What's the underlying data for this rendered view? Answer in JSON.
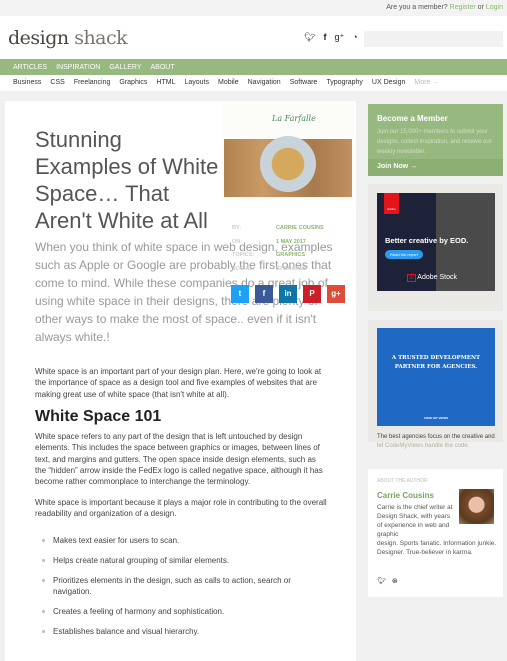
{
  "topbar": {
    "question": "Are you a member?",
    "register": "Register",
    "or": "or",
    "login": "Login"
  },
  "logo": {
    "word1": "design",
    "word2": "shack"
  },
  "social_icons": [
    "twitter-icon",
    "facebook-icon",
    "google-plus-icon",
    "rss-icon"
  ],
  "nav": [
    "ARTICLES",
    "INSPIRATION",
    "GALLERY",
    "ABOUT"
  ],
  "subnav": [
    "Business",
    "CSS",
    "Freelancing",
    "Graphics",
    "HTML",
    "Layouts",
    "Mobile",
    "Navigation",
    "Software",
    "Typography",
    "UX Design",
    "More →"
  ],
  "article": {
    "title": "Stunning Examples of White Space… That Aren't White at All",
    "lead": "When you think of white space in web design, examples such as Apple or Google are probably the first ones that come to mind. While these companies do a great job of using white space in their designs, there are plenty of other ways to make the most of space.. even if it isn't always white.!",
    "image_logo": "La Farfalle",
    "meta": [
      {
        "k": "BY:",
        "v": "CARRIE COUSINS"
      },
      {
        "k": "ON:",
        "v": "1 MAY 2017"
      },
      {
        "k": "TOPICS:",
        "v": "GRAPHICS"
      },
      {
        "k": "SOCIAL:",
        "v": "32 SHARES"
      }
    ],
    "share": [
      {
        "icon": "twitter-icon",
        "glyph": "t",
        "color": "#1da1f2"
      },
      {
        "icon": "facebook-icon",
        "glyph": "f",
        "color": "#3b5998"
      },
      {
        "icon": "linkedin-icon",
        "glyph": "in",
        "color": "#0e76a8"
      },
      {
        "icon": "pinterest-icon",
        "glyph": "P",
        "color": "#cb2027"
      },
      {
        "icon": "google-plus-icon",
        "glyph": "g+",
        "color": "#dd4b39"
      }
    ],
    "p1": "White space is an important part of your design plan. Here, we're going to look at the importance of space as a design tool and five examples of websites that are making great use of white space (that isn't white at all).",
    "h2": "White Space 101",
    "p2": "White space refers to any part of the design that is left untouched by design elements. This includes the space between graphics or images, between lines of text, and margins and gutters. The open space inside design elements, such as the “hidden” arrow inside the FedEx logo is called negative space, although it has become rather commonplace to interchange the terminology.",
    "p3": "White space is important because it plays a major role in contributing to the overall readability and organization of a design.",
    "bullets": [
      "Makes text easier for users to scan.",
      "Helps create natural grouping of similar elements.",
      "Prioritizes elements in the design, such as calls to action, search or navigation.",
      "Creates a feeling of harmony and sophistication.",
      "Establishes balance and visual hierarchy."
    ]
  },
  "sidebar": {
    "member": {
      "title": "Become a Member",
      "text": "Join our 15,000+ members to submit your designs, collect inspiration, and receive our weekly newsletter.",
      "cta": "Join Now →"
    },
    "ad1": {
      "headline": "Better creative by EOD.",
      "button": "Read the report",
      "brand": "Adobe Stock",
      "badge": "Adobe"
    },
    "ad2": {
      "headline": "A TRUSTED DEVELOPMENT PARTNER FOR AGENCIES.",
      "brand": "CODE MY VIEWS",
      "caption": "The best agencies focus on the creative and",
      "link": "let CodeMyViews handle the code."
    },
    "author": {
      "label": "ABOUT THE AUTHOR",
      "name": "Carrie Cousins",
      "bio1": "Carrie is the chief writer at Design Shack, with years of experience in web and graphic",
      "bio2": "design. Sports fanatic. Information junkie. Designer. True-believer in karma."
    }
  }
}
